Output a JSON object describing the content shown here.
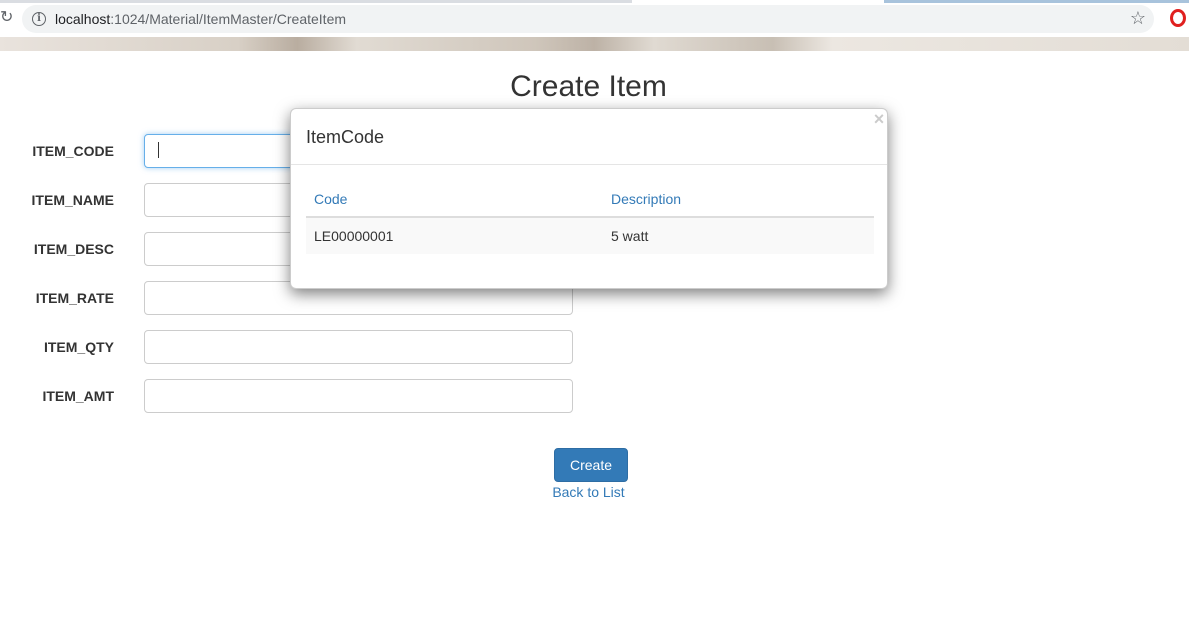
{
  "browser": {
    "url_host": "localhost",
    "url_path": ":1024/Material/ItemMaster/CreateItem",
    "icons": {
      "reload": "reload-icon",
      "info": "info-icon",
      "bookmark": "star-icon",
      "opera": "opera-icon"
    }
  },
  "page": {
    "title": "Create Item",
    "fields": [
      {
        "label": "ITEM_CODE",
        "value": ""
      },
      {
        "label": "ITEM_NAME",
        "value": ""
      },
      {
        "label": "ITEM_DESC",
        "value": ""
      },
      {
        "label": "ITEM_RATE",
        "value": ""
      },
      {
        "label": "ITEM_QTY",
        "value": ""
      },
      {
        "label": "ITEM_AMT",
        "value": ""
      }
    ],
    "create_label": "Create",
    "back_label": "Back to List"
  },
  "modal": {
    "title": "ItemCode",
    "close_glyph": "×",
    "columns": [
      "Code",
      "Description"
    ],
    "rows": [
      {
        "code": "LE00000001",
        "description": "5 watt"
      }
    ]
  },
  "colors": {
    "primary": "#337ab7",
    "focus_border": "#66afe9",
    "opera_red": "#e0201f"
  }
}
